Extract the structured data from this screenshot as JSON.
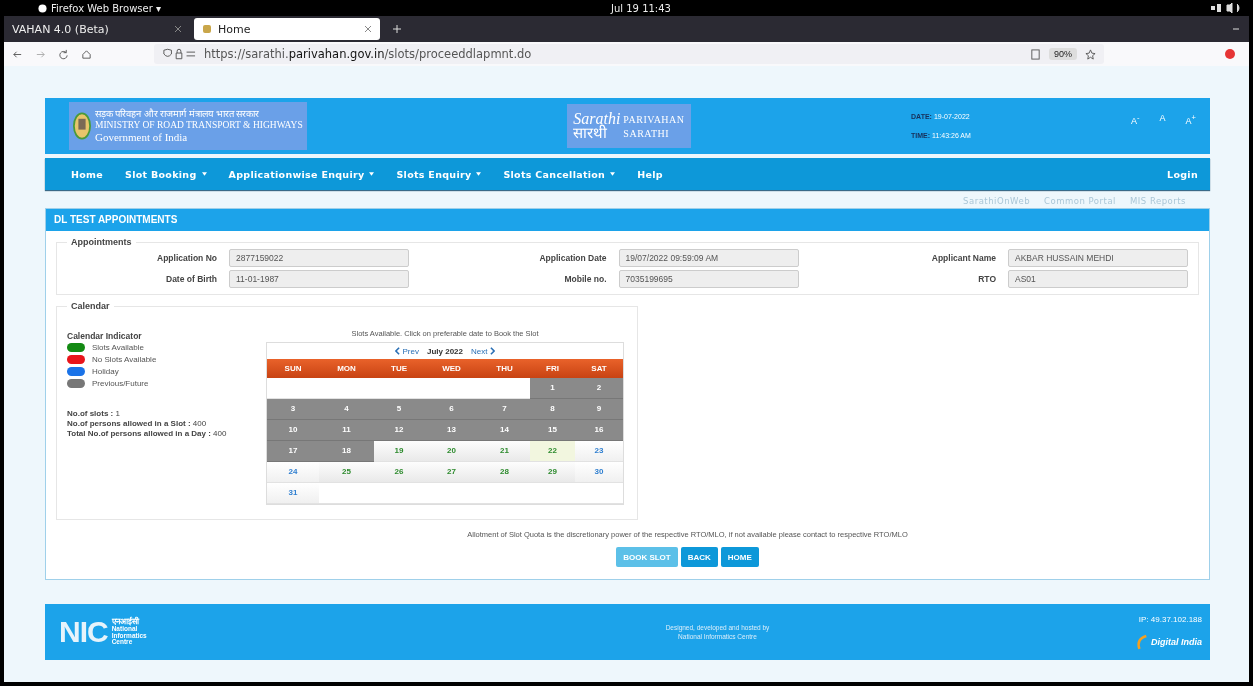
{
  "system_bar": {
    "app": "Firefox Web Browser ▾",
    "clock": "Jul 19  11:43"
  },
  "browser_tabs": [
    {
      "label": "VAHAN 4.0 (Beta)",
      "selected": false
    },
    {
      "label": "Home",
      "selected": true
    }
  ],
  "address_bar": {
    "url_prefix": "https://sarathi.",
    "url_domain": "parivahan.gov.in",
    "url_path": "/slots/proceeddlapmnt.do",
    "zoom": "90%"
  },
  "header": {
    "ministry_hindi": "सड़क परिवहन और राजमार्ग मंत्रालय भारत सरकार",
    "ministry": "MINISTRY OF ROAD TRANSPORT & HIGHWAYS",
    "government": "Government of India",
    "logo_text": "Sarathi",
    "logo_hindi": "सारथी",
    "brand_1": "PARIVAHAN",
    "brand_2": "SARATHI",
    "date_label": "DATE:",
    "date": "19-07-2022",
    "time_label": "TIME:",
    "time": "11:43:26 AM",
    "font_sizes": [
      "A$^{-}$",
      "A",
      "A$^{+}$"
    ]
  },
  "nav": {
    "items": [
      {
        "label": "Home",
        "dropdown": false
      },
      {
        "label": "Slot Booking",
        "dropdown": true
      },
      {
        "label": "Applicationwise Enquiry",
        "dropdown": true
      },
      {
        "label": "Slots Enquiry",
        "dropdown": true
      },
      {
        "label": "Slots Cancellation",
        "dropdown": true
      },
      {
        "label": "Help",
        "dropdown": false
      }
    ],
    "login": "Login"
  },
  "quick_links": [
    "SarathiOnWeb",
    "Common Portal",
    "MIS Reports"
  ],
  "panel_title": "DL TEST APPOINTMENTS",
  "appointments": {
    "legend": "Appointments",
    "fields": [
      {
        "label": "Application No",
        "value": "2877159022"
      },
      {
        "label": "Application Date",
        "value": "19/07/2022 09:59:09 AM"
      },
      {
        "label": "Applicant Name",
        "value": "AKBAR HUSSAIN MEHDI"
      },
      {
        "label": "Date of Birth",
        "value": "11-01-1987"
      },
      {
        "label": "Mobile no.",
        "value": "7035199695"
      },
      {
        "label": "RTO",
        "value": "AS01"
      }
    ]
  },
  "calendar": {
    "legend": "Calendar",
    "indicator_title": "Calendar Indicator",
    "indicators": [
      {
        "label": "Slots Available",
        "color": "#138a13"
      },
      {
        "label": "No Slots Available",
        "color": "#e8151b"
      },
      {
        "label": "Holiday",
        "color": "#1a73e8"
      },
      {
        "label": "Previous/Future",
        "color": "#777777"
      }
    ],
    "stats": [
      {
        "label": "No.of slots :",
        "value": "1"
      },
      {
        "label": "No.of persons allowed in a Slot :",
        "value": "400"
      },
      {
        "label": "Total No.of persons allowed in a Day :",
        "value": "400"
      }
    ],
    "hint": "Slots Available. Click on preferable date to Book the Slot",
    "prev": "Prev",
    "month": "July 2022",
    "next": "Next",
    "weekdays": [
      "SUN",
      "MON",
      "TUE",
      "WED",
      "THU",
      "FRI",
      "SAT"
    ],
    "weeks": [
      [
        {
          "kind": "blank"
        },
        {
          "kind": "blank"
        },
        {
          "kind": "blank"
        },
        {
          "kind": "blank"
        },
        {
          "kind": "blank"
        },
        {
          "day": "1",
          "kind": "past"
        },
        {
          "day": "2",
          "kind": "past"
        }
      ],
      [
        {
          "day": "3",
          "kind": "past"
        },
        {
          "day": "4",
          "kind": "past"
        },
        {
          "day": "5",
          "kind": "past"
        },
        {
          "day": "6",
          "kind": "past"
        },
        {
          "day": "7",
          "kind": "past"
        },
        {
          "day": "8",
          "kind": "past"
        },
        {
          "day": "9",
          "kind": "past"
        }
      ],
      [
        {
          "day": "10",
          "kind": "past"
        },
        {
          "day": "11",
          "kind": "past"
        },
        {
          "day": "12",
          "kind": "past"
        },
        {
          "day": "13",
          "kind": "past"
        },
        {
          "day": "14",
          "kind": "past"
        },
        {
          "day": "15",
          "kind": "past"
        },
        {
          "day": "16",
          "kind": "past"
        }
      ],
      [
        {
          "day": "17",
          "kind": "past"
        },
        {
          "day": "18",
          "kind": "past"
        },
        {
          "day": "19",
          "kind": "available"
        },
        {
          "day": "20",
          "kind": "available"
        },
        {
          "day": "21",
          "kind": "available"
        },
        {
          "day": "22",
          "kind": "highlighted"
        },
        {
          "day": "23",
          "kind": "holiday"
        }
      ],
      [
        {
          "day": "24",
          "kind": "holiday"
        },
        {
          "day": "25",
          "kind": "available"
        },
        {
          "day": "26",
          "kind": "available"
        },
        {
          "day": "27",
          "kind": "available"
        },
        {
          "day": "28",
          "kind": "available"
        },
        {
          "day": "29",
          "kind": "available"
        },
        {
          "day": "30",
          "kind": "holiday"
        }
      ],
      [
        {
          "day": "31",
          "kind": "holiday"
        },
        {
          "kind": "blank"
        },
        {
          "kind": "blank"
        },
        {
          "kind": "blank"
        },
        {
          "kind": "blank"
        },
        {
          "kind": "blank"
        },
        {
          "kind": "blank"
        }
      ]
    ]
  },
  "note": "Allotment of Slot Quota is the discretionary power of the respective RTO/MLO, if not available please contact to respective RTO/MLO",
  "buttons": [
    {
      "label": "BOOK SLOT",
      "disabled": true
    },
    {
      "label": "BACK",
      "disabled": false
    },
    {
      "label": "HOME",
      "disabled": false
    }
  ],
  "footer": {
    "nic_logo": "NIC",
    "nic_hindi": "एनआईसी",
    "nic_lines": [
      "National",
      "Informatics",
      "Centre"
    ],
    "credit_1": "Designed, developed and hosted by",
    "credit_2": "National Informatics Centre",
    "ip": "IP: 49.37.102.188",
    "digital_india": "Digital India"
  }
}
